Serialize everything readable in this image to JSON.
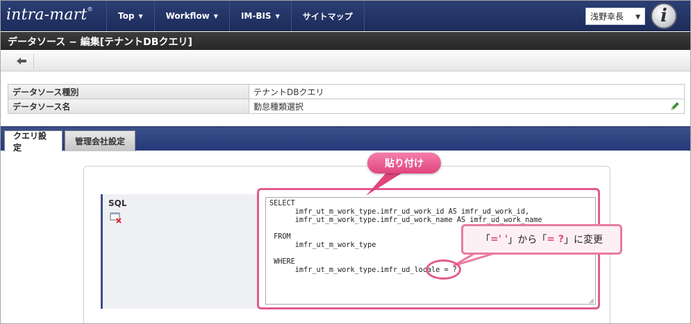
{
  "header": {
    "logo_text": "intra-mart",
    "logo_mark": "®",
    "nav": [
      {
        "label": "Top"
      },
      {
        "label": "Workflow"
      },
      {
        "label": "IM-BIS"
      },
      {
        "label": "サイトマップ"
      }
    ],
    "user_name": "浅野幸長",
    "brand_badge": "i"
  },
  "page": {
    "title": "データソース − 編集[テナントDBクエリ]"
  },
  "info": {
    "rows": [
      {
        "label": "データソース種別",
        "value": "テナントDBクエリ"
      },
      {
        "label": "データソース名",
        "value": "勤怠種類選択"
      }
    ]
  },
  "tabs": [
    {
      "label": "クエリ設定",
      "active": true
    },
    {
      "label": "管理会社設定",
      "active": false
    }
  ],
  "sql": {
    "label": "SQL",
    "value": "SELECT\n      imfr_ut_m_work_type.imfr_ud_work_id AS imfr_ud_work_id,\n      imfr_ut_m_work_type.imfr_ud_work_name AS imfr_ud_work_name\n\n FROM\n      imfr_ut_m_work_type\n\n WHERE\n      imfr_ut_m_work_type.imfr_ud_locale = ?"
  },
  "annotations": {
    "paste_label": "貼り付け",
    "change_prefix": "「",
    "change_from": "=' '",
    "change_middle": "」から「",
    "change_to": "= ?",
    "change_suffix": "」に変更"
  },
  "colors": {
    "nav_bg": "#1c2c5b",
    "tab_bar": "#26397a",
    "accent_pink": "#e0457d"
  }
}
